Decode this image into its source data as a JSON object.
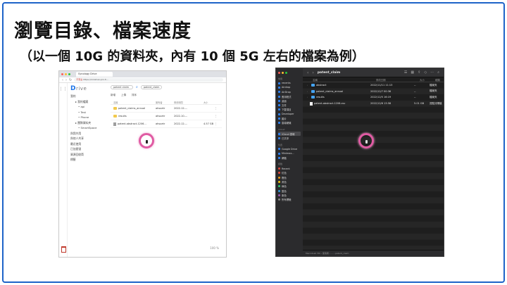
{
  "slide": {
    "title": "瀏覽目錄、檔案速度",
    "subtitle": "（以一個 10G 的資料夾，內有 10 個 5G 左右的檔案為例）",
    "frame_color": "#1e63c8",
    "cursor_highlight_color": "#e05ba3"
  },
  "browser": {
    "tab_title": "Synology Drive",
    "address": {
      "secure_label": "不安全",
      "url": "https://minimax-pro.ti..."
    },
    "drive": {
      "logo_text": "D",
      "logo_suffix": "rive",
      "search_value": "patent claim",
      "search_scope": "patent_claim",
      "toolbar": [
        "新增",
        "上傳",
        "排序"
      ],
      "sidebar": [
        {
          "label": "我的",
          "level": 0
        },
        {
          "label": "我的檔案",
          "level": 1
        },
        {
          "label": "api",
          "level": 2
        },
        {
          "label": "Test",
          "level": 2
        },
        {
          "label": "Phone",
          "level": 2
        },
        {
          "label": "團隊資料夾",
          "level": 1
        },
        {
          "label": "SmartSpace",
          "level": 2
        },
        {
          "label": "與我共用",
          "level": 0
        },
        {
          "label": "與他人共享",
          "level": 0
        },
        {
          "label": "最近使用",
          "level": 0
        },
        {
          "label": "已加星號",
          "level": 0
        },
        {
          "label": "資源回收筒",
          "level": 0
        },
        {
          "label": "標籤",
          "level": 0
        }
      ],
      "columns": [
        "名稱",
        "擁有者",
        "修改時間",
        "大小",
        ""
      ],
      "rows": [
        {
          "name": "patent_claims_annual",
          "type": "folder",
          "owner": "ahsuetr",
          "modified": "2022-12-...",
          "size": ""
        },
        {
          "name": "results",
          "type": "folder",
          "owner": "ahsuetr",
          "modified": "2022-10-...",
          "size": ""
        },
        {
          "name": "patent-abstract-1206...",
          "type": "file",
          "owner": "ahsuetr",
          "modified": "2022-12-...",
          "size": "4.57 GB"
        }
      ],
      "zoom_text": "100 %"
    }
  },
  "finder": {
    "folder_title": "patent_claim",
    "sidebar": [
      {
        "kind": "group",
        "label": "常用"
      },
      {
        "kind": "item",
        "label": "recents"
      },
      {
        "kind": "item",
        "label": "Airdrop"
      },
      {
        "kind": "item",
        "label": "AirDrop"
      },
      {
        "kind": "item",
        "label": "應用程式"
      },
      {
        "kind": "item",
        "label": "桌面"
      },
      {
        "kind": "item",
        "label": "文件"
      },
      {
        "kind": "item",
        "label": "下載項目"
      },
      {
        "kind": "item",
        "label": "Developer"
      },
      {
        "kind": "item",
        "label": "圖片"
      },
      {
        "kind": "item",
        "label": "雲端硬碟"
      },
      {
        "kind": "group",
        "label": "iCloud"
      },
      {
        "kind": "item",
        "label": "iCloud 雲碟",
        "selected": true
      },
      {
        "kind": "item",
        "label": "已共享"
      },
      {
        "kind": "group",
        "label": "位置"
      },
      {
        "kind": "item",
        "label": "Google Drive"
      },
      {
        "kind": "item",
        "label": "Minimax..."
      },
      {
        "kind": "item",
        "label": "網路"
      },
      {
        "kind": "group",
        "label": "標籤"
      },
      {
        "kind": "tag",
        "label": "Recent",
        "color": "#e74c3c"
      },
      {
        "kind": "tag",
        "label": "紅色",
        "color": "#e74c3c"
      },
      {
        "kind": "tag",
        "label": "橙色",
        "color": "#f39c12"
      },
      {
        "kind": "tag",
        "label": "黃色",
        "color": "#f1c40f"
      },
      {
        "kind": "tag",
        "label": "綠色",
        "color": "#2ecc71"
      },
      {
        "kind": "tag",
        "label": "藍色",
        "color": "#3498db"
      },
      {
        "kind": "tag",
        "label": "紫色",
        "color": "#9b59b6"
      },
      {
        "kind": "tag",
        "label": "所有標籤",
        "color": "#888888"
      }
    ],
    "columns": [
      "名稱",
      "修改日期",
      "大小",
      "種類"
    ],
    "rows": [
      {
        "name": "abstract",
        "type": "folder",
        "modified": "2022/11/11 11:13",
        "size": "--",
        "kind": "檔案夾"
      },
      {
        "name": "patent_claims_annual",
        "type": "folder",
        "modified": "2022/12/7 00:36",
        "size": "--",
        "kind": "檔案夾"
      },
      {
        "name": "results",
        "type": "folder",
        "modified": "2022/12/5 16:19",
        "size": "--",
        "kind": "檔案夾"
      },
      {
        "name": "patent-abstract-1206.csv",
        "type": "file",
        "modified": "2022/12/6 13:58",
        "size": "5.01 GB",
        "kind": "逗點分隔值"
      }
    ],
    "path_bar": "Macintosh HD › 使用者 › ... › patent_claim"
  }
}
